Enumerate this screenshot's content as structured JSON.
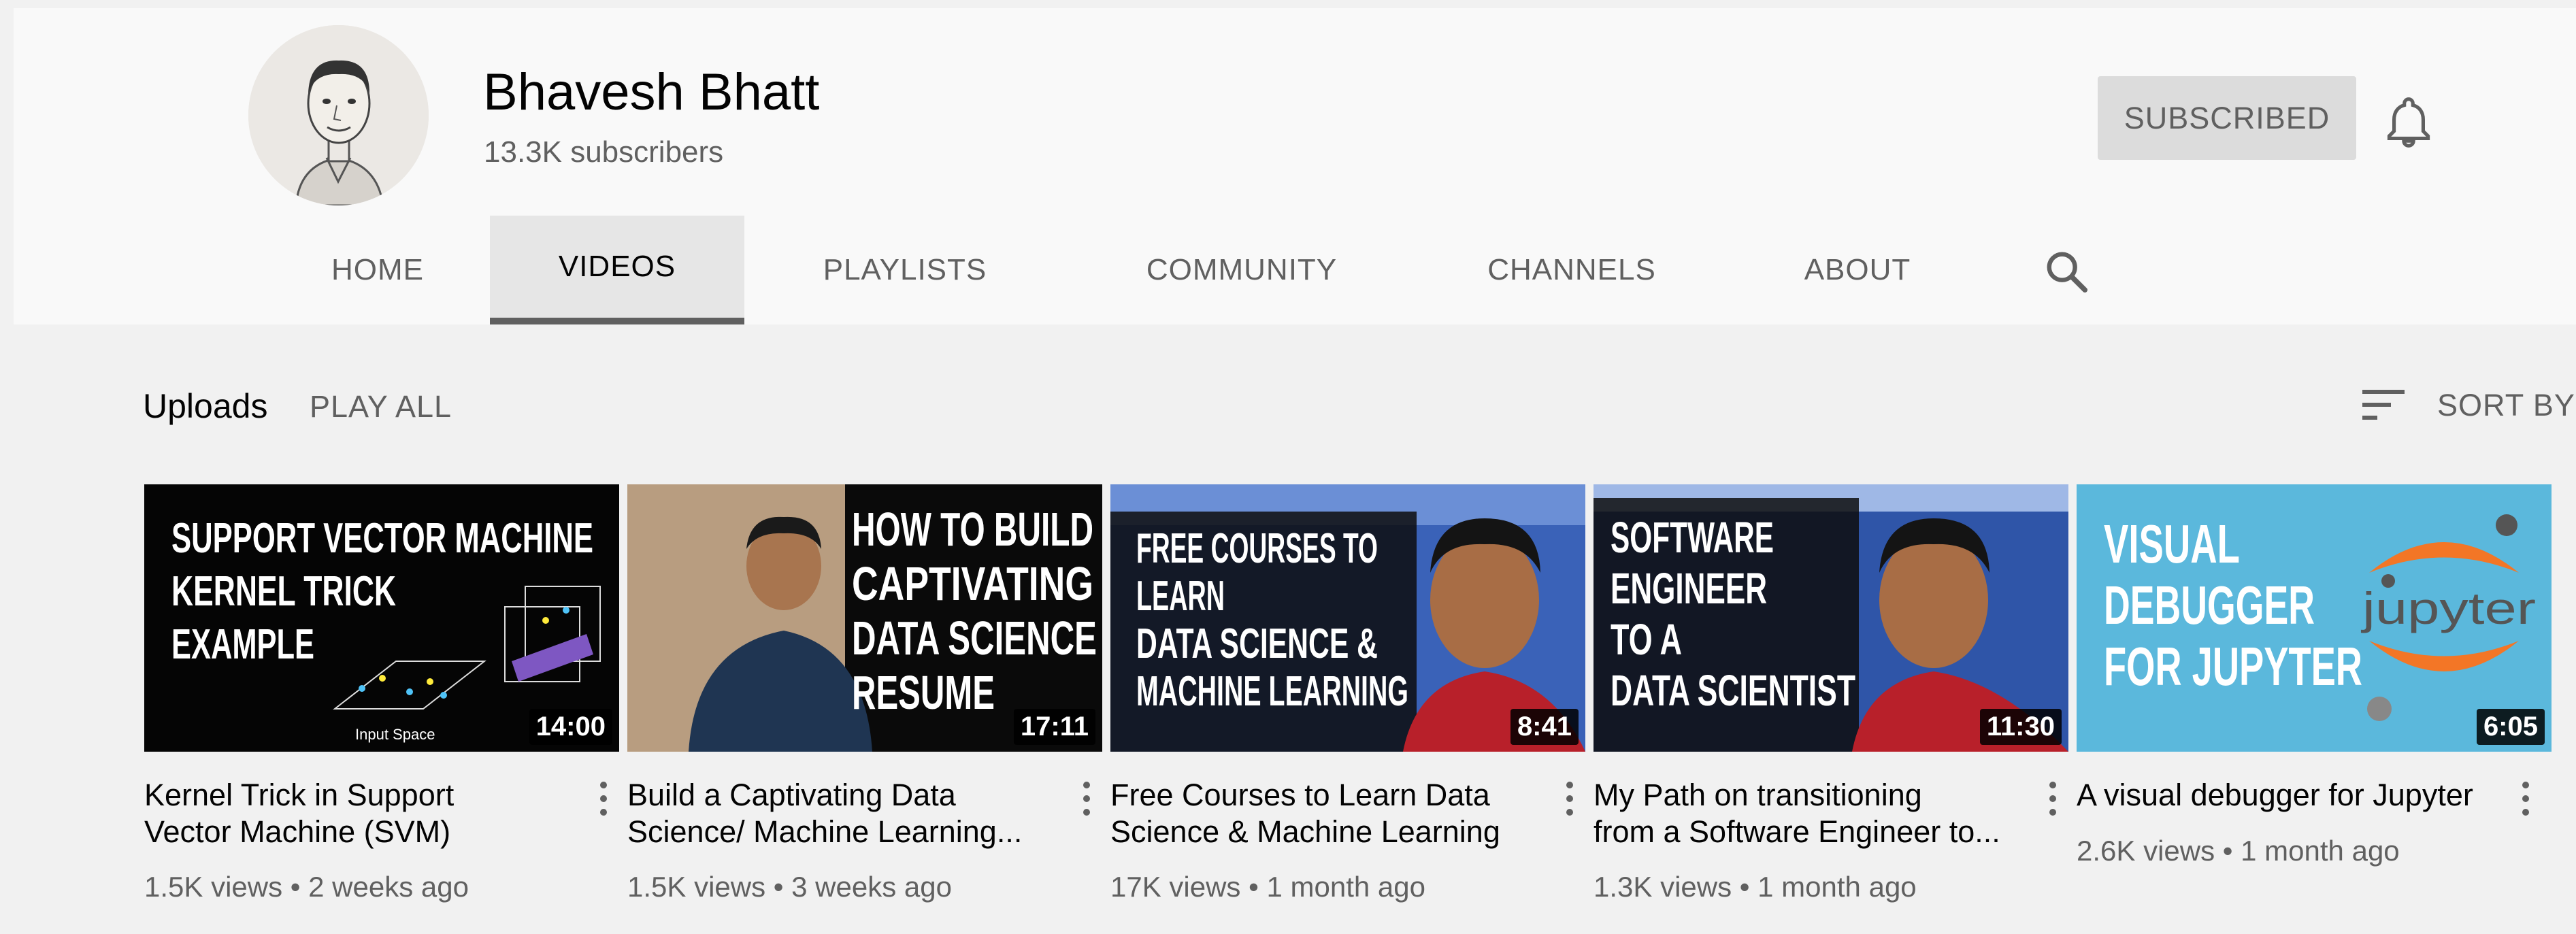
{
  "channel": {
    "name": "Bhavesh Bhatt",
    "subscribers": "13.3K subscribers",
    "subscribe_label": "SUBSCRIBED"
  },
  "tabs": [
    {
      "label": "HOME"
    },
    {
      "label": "VIDEOS"
    },
    {
      "label": "PLAYLISTS"
    },
    {
      "label": "COMMUNITY"
    },
    {
      "label": "CHANNELS"
    },
    {
      "label": "ABOUT"
    }
  ],
  "active_tab": "VIDEOS",
  "section": {
    "title": "Uploads",
    "play_all": "PLAY ALL",
    "sort_by": "SORT BY"
  },
  "videos": [
    {
      "thumb_text": [
        "SUPPORT VECTOR MACHINE",
        "KERNEL TRICK",
        "EXAMPLE"
      ],
      "thumb_caption": "Input Space",
      "duration": "14:00",
      "title_line1": "Kernel Trick in Support",
      "title_line2": "Vector Machine (SVM)",
      "views": "1.5K views",
      "age": "2 weeks ago"
    },
    {
      "thumb_text": [
        "HOW TO BUILD",
        "CAPTIVATING",
        "DATA SCIENCE",
        "RESUME"
      ],
      "duration": "17:11",
      "title_line1": "Build a Captivating Data",
      "title_line2": "Science/ Machine Learning...",
      "views": "1.5K views",
      "age": "3 weeks ago"
    },
    {
      "thumb_text": [
        "FREE COURSES TO",
        "LEARN",
        "DATA SCIENCE &",
        "MACHINE LEARNING"
      ],
      "duration": "8:41",
      "title_line1": "Free Courses to Learn Data",
      "title_line2": "Science & Machine Learning",
      "views": "17K views",
      "age": "1 month ago"
    },
    {
      "thumb_text": [
        "SOFTWARE",
        "ENGINEER",
        "TO A",
        "DATA SCIENTIST"
      ],
      "duration": "11:30",
      "title_line1": "My Path on transitioning",
      "title_line2": "from a Software Engineer to...",
      "views": "1.3K views",
      "age": "1 month ago"
    },
    {
      "thumb_text": [
        "VISUAL",
        "DEBUGGER",
        "FOR JUPYTER"
      ],
      "thumb_logo": "jupyter",
      "duration": "6:05",
      "title_line1": "A visual debugger for Jupyter",
      "title_line2": "",
      "views": "2.6K views",
      "age": "1 month ago"
    }
  ],
  "meta_separator": "•",
  "colors": {
    "page_bg": "#f1f1f1",
    "header_bg": "#f9f9f9",
    "subscribed_bg": "#dcdcdc",
    "secondary_text": "#606060",
    "jupyter_bg": "#5bb8dc",
    "jupyter_orange": "#f37626"
  },
  "icons": {
    "bell": "bell-icon",
    "search": "search-icon",
    "sort": "sort-icon",
    "kebab": "more-vert-icon"
  }
}
